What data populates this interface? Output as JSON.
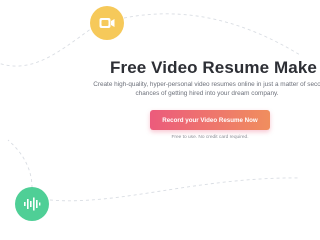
{
  "hero": {
    "title": "Free Video Resume Make",
    "description_lines": [
      "Create high-quality, hyper-personal video resumes online in just a matter of seco",
      "chances of getting hired into your dream company."
    ],
    "cta_label": "Record your Video Resume Now",
    "note": "Free to use. No credit card required."
  },
  "decor": {
    "top_badge_icon": "video-camera-icon",
    "bottom_badge_icon": "audio-wave-icon"
  },
  "colors": {
    "accent_yellow": "#f6c95a",
    "accent_green": "#4fcf96",
    "cta_gradient_start": "#ec5b7c",
    "cta_gradient_end": "#f08e5e",
    "title": "#2d2f35",
    "body_text": "#6c707a"
  }
}
